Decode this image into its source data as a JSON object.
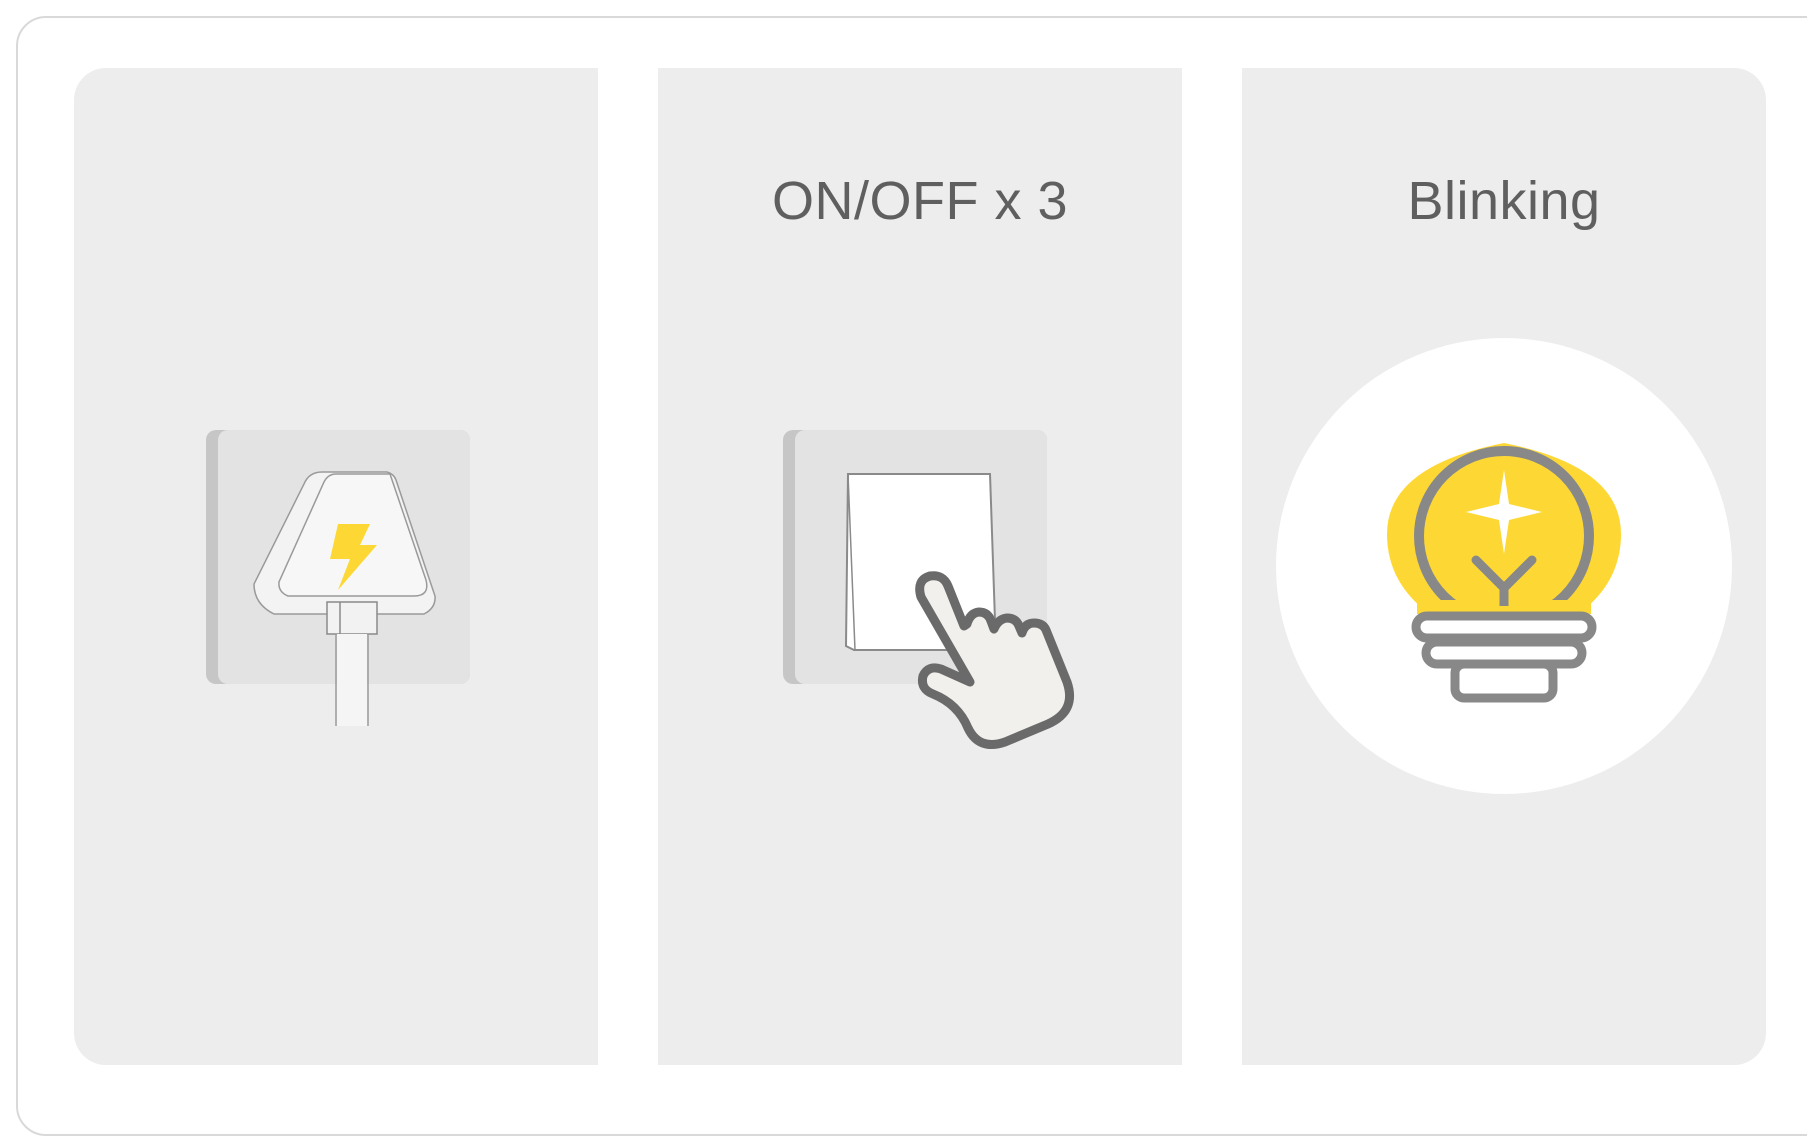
{
  "steps": [
    {
      "label": "",
      "icon": "power-plug-icon"
    },
    {
      "label": "ON/OFF x 3",
      "icon": "wall-switch-press-icon"
    },
    {
      "label": "Blinking",
      "icon": "blinking-bulb-icon"
    }
  ],
  "colors": {
    "panel_bg": "#ededed",
    "border": "#d9d9d9",
    "text": "#5f5f5f",
    "accent_yellow": "#fdd835",
    "outline_gray": "#888888",
    "hand_fill": "#f2f0ec"
  }
}
